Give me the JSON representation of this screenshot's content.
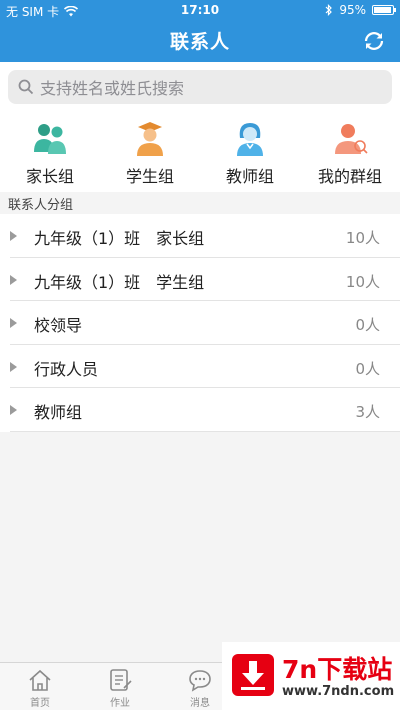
{
  "status": {
    "carrier": "无 SIM 卡",
    "time": "17:10",
    "battery": "95%",
    "battery_level": 0.95
  },
  "header": {
    "title": "联系人"
  },
  "search": {
    "placeholder": "支持姓名或姓氏搜索"
  },
  "groups": [
    {
      "label": "家长组",
      "icon": "parents-icon",
      "color": "#3cb6a0"
    },
    {
      "label": "学生组",
      "icon": "student-icon",
      "color": "#f0a14a"
    },
    {
      "label": "教师组",
      "icon": "teacher-icon",
      "color": "#4fb2e8"
    },
    {
      "label": "我的群组",
      "icon": "my-group-icon",
      "color": "#f07c5c"
    }
  ],
  "section": {
    "title": "联系人分组"
  },
  "contact_groups": [
    {
      "name": "九年级（1）班　家长组",
      "count": "10人"
    },
    {
      "name": "九年级（1）班　学生组",
      "count": "10人"
    },
    {
      "name": "校领导",
      "count": "0人"
    },
    {
      "name": "行政人员",
      "count": "0人"
    },
    {
      "name": "教师组",
      "count": "3人"
    }
  ],
  "tabbar": {
    "items": [
      {
        "label": "首页"
      },
      {
        "label": "作业"
      },
      {
        "label": "消息"
      }
    ]
  },
  "watermark": {
    "brand": "7n下载站",
    "url": "www.7ndn.com"
  },
  "colors": {
    "header": "#2f93dc",
    "accent": "#e60012"
  }
}
